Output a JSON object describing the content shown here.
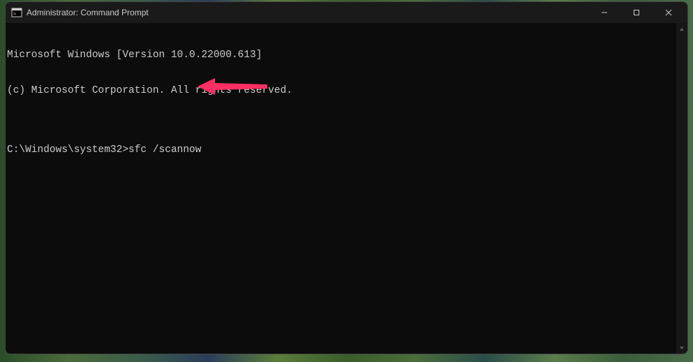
{
  "window": {
    "title": "Administrator: Command Prompt"
  },
  "terminal": {
    "line1": "Microsoft Windows [Version 10.0.22000.613]",
    "line2": "(c) Microsoft Corporation. All rights reserved.",
    "blank": "",
    "prompt": "C:\\Windows\\system32>",
    "command": "sfc /scannow"
  },
  "controls": {
    "minimize": "─",
    "maximize": "☐",
    "close": "✕"
  },
  "annotation": {
    "color": "#ff2e63"
  }
}
